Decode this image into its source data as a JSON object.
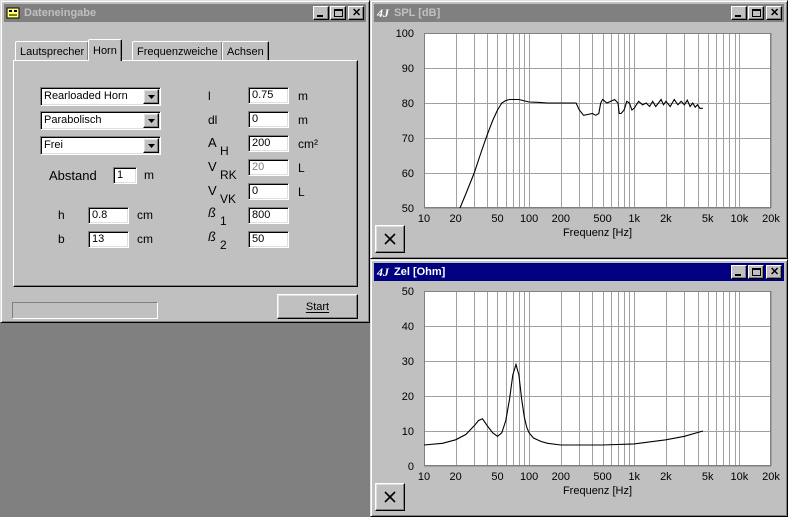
{
  "dialog": {
    "title": "Dateneingabe",
    "tabs": [
      {
        "label": "Lautsprecher"
      },
      {
        "label": "Horn"
      },
      {
        "label": "Frequenzweiche"
      },
      {
        "label": "Achsen"
      }
    ],
    "selected_tab": "Horn",
    "combos": [
      {
        "value": "Rearloaded Horn"
      },
      {
        "value": "Parabolisch"
      },
      {
        "value": "Frei"
      }
    ],
    "abstand": {
      "label": "Abstand",
      "value": "1",
      "unit": "m"
    },
    "h": {
      "label": "h",
      "value": "0.8",
      "unit": "cm"
    },
    "b": {
      "label": "b",
      "value": "13",
      "unit": "cm"
    },
    "params": [
      {
        "sym": "l",
        "sub": "",
        "value": "0.75",
        "unit": "m"
      },
      {
        "sym": "dl",
        "sub": "",
        "value": "0",
        "unit": "m"
      },
      {
        "sym": "A",
        "sub": "H",
        "value": "200",
        "unit": "cm²"
      },
      {
        "sym": "V",
        "sub": "RK",
        "value": "20",
        "unit": "L",
        "disabled": true
      },
      {
        "sym": "V",
        "sub": "VK",
        "value": "0",
        "unit": "L"
      },
      {
        "sym": "ß",
        "sub": "1",
        "value": "800",
        "unit": ""
      },
      {
        "sym": "ß",
        "sub": "2",
        "value": "50",
        "unit": ""
      }
    ],
    "start_label": "Start",
    "progress": 0
  },
  "spl_window": {
    "title": "SPL [dB]",
    "chart_data": {
      "type": "line",
      "xlabel": "Frequenz [Hz]",
      "x_scale": "log",
      "xlim": [
        10,
        20000
      ],
      "ylim": [
        50,
        100
      ],
      "x_ticks": [
        "10",
        "20",
        "50",
        "100",
        "200",
        "500",
        "1k",
        "2k",
        "5k",
        "10k",
        "20k"
      ],
      "y_ticks": [
        "100",
        "90",
        "80",
        "70",
        "60",
        "50"
      ],
      "grid": true,
      "series": [
        {
          "x": [
            22,
            25,
            30,
            35,
            40,
            45,
            50,
            55,
            60,
            65,
            70,
            80,
            90,
            100,
            120,
            150,
            200,
            250,
            280,
            300,
            330,
            360,
            400,
            430,
            460,
            480,
            500,
            550,
            600,
            650,
            700,
            720,
            750,
            800,
            850,
            900,
            950,
            1000,
            1100,
            1200,
            1300,
            1400,
            1500,
            1600,
            1700,
            1800,
            1900,
            2000,
            2200,
            2400,
            2600,
            2800,
            3000,
            3200,
            3400,
            3600,
            3800,
            4000,
            4200,
            4500
          ],
          "y": [
            50,
            54,
            60,
            66,
            71,
            75,
            78,
            80,
            80.7,
            81,
            81,
            81,
            80.6,
            80.3,
            80.2,
            80,
            80,
            80,
            80,
            78,
            76.5,
            76.7,
            77,
            76.5,
            77,
            80,
            81,
            80,
            80.5,
            81,
            80,
            77,
            77,
            78,
            80.5,
            80,
            78,
            78.5,
            80.5,
            79.5,
            80,
            79,
            80.5,
            79,
            80,
            81,
            79.5,
            80.5,
            79,
            81,
            79.5,
            80.5,
            79.5,
            80.8,
            79,
            80,
            78.8,
            79.5,
            78.5,
            78.5
          ]
        }
      ]
    }
  },
  "zel_window": {
    "title": "Zel [Ohm]",
    "chart_data": {
      "type": "line",
      "xlabel": "Frequenz [Hz]",
      "x_scale": "log",
      "xlim": [
        10,
        20000
      ],
      "ylim": [
        0,
        50
      ],
      "x_ticks": [
        "10",
        "20",
        "50",
        "100",
        "200",
        "500",
        "1k",
        "2k",
        "5k",
        "10k",
        "20k"
      ],
      "y_ticks": [
        "50",
        "40",
        "30",
        "20",
        "10",
        "0"
      ],
      "grid": true,
      "series": [
        {
          "x": [
            10,
            15,
            20,
            25,
            30,
            33,
            36,
            40,
            45,
            50,
            55,
            60,
            65,
            70,
            75,
            80,
            85,
            90,
            95,
            100,
            110,
            130,
            150,
            200,
            300,
            500,
            1000,
            2000,
            3000,
            4500
          ],
          "y": [
            6,
            6.5,
            7.5,
            9,
            11.5,
            13,
            13.5,
            11.5,
            9.5,
            8.5,
            9.5,
            13,
            19,
            26,
            29,
            26,
            19,
            14,
            11,
            9.5,
            8,
            7,
            6.5,
            6,
            6,
            6,
            6.3,
            7.5,
            8.5,
            10
          ]
        }
      ]
    }
  }
}
